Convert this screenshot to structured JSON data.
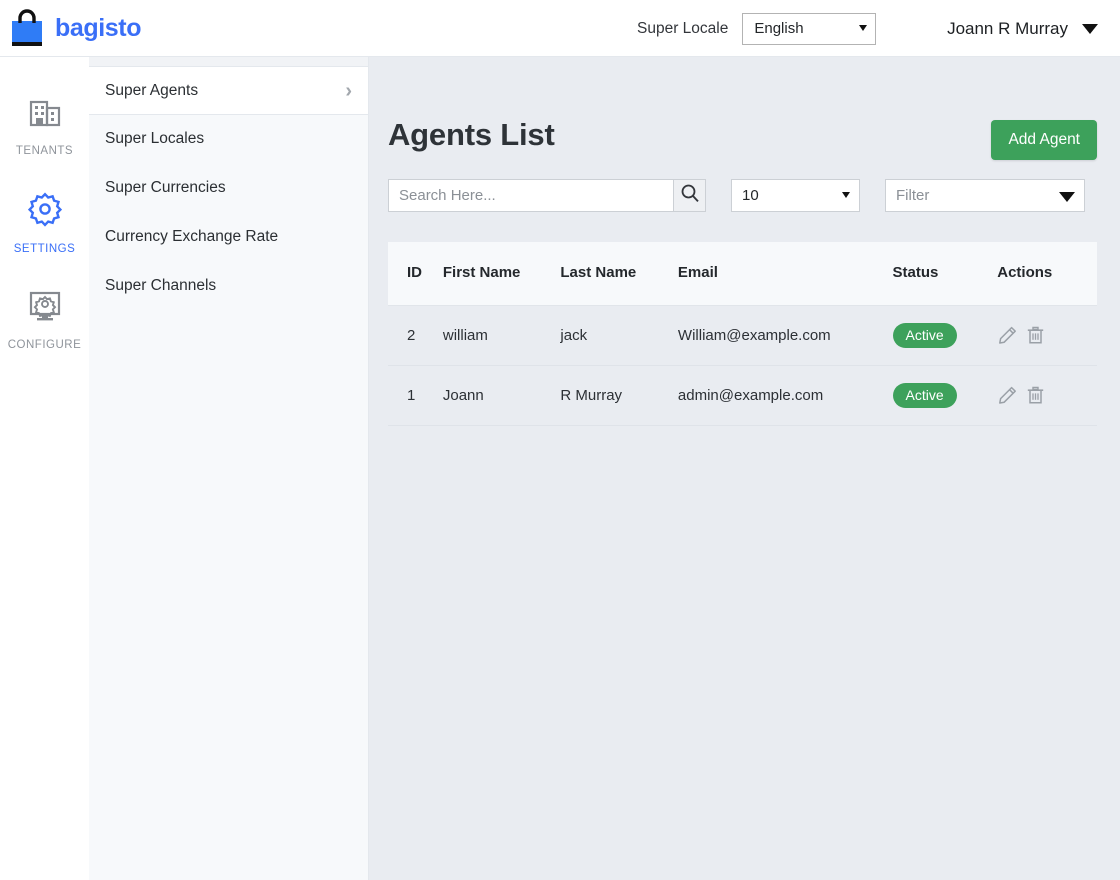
{
  "brand": {
    "name": "bagisto",
    "logo_icon": "shopping-bag-icon",
    "color": "#3a6ff7"
  },
  "header": {
    "super_locale_label": "Super Locale",
    "locale_value": "English",
    "locale_options": [
      "English"
    ],
    "user_name": "Joann R Murray",
    "user_caret_icon": "chevron-down-icon"
  },
  "rail": {
    "items": [
      {
        "label": "TENANTS",
        "icon": "building-icon",
        "active": false
      },
      {
        "label": "SETTINGS",
        "icon": "gear-icon",
        "active": true
      },
      {
        "label": "CONFIGURE",
        "icon": "monitor-gear-icon",
        "active": false
      }
    ]
  },
  "nav": {
    "items": [
      {
        "label": "Super Agents",
        "active": true,
        "chevron": "chevron-right-icon"
      },
      {
        "label": "Super Locales",
        "active": false
      },
      {
        "label": "Super Currencies",
        "active": false
      },
      {
        "label": "Currency Exchange Rate",
        "active": false
      },
      {
        "label": "Super Channels",
        "active": false
      }
    ]
  },
  "page": {
    "title": "Agents List",
    "add_button": "Add Agent",
    "add_button_color": "#3da15b"
  },
  "toolbar": {
    "search_placeholder": "Search Here...",
    "search_value": "",
    "search_icon": "search-icon",
    "per_page_value": "10",
    "per_page_options": [
      "10"
    ],
    "filter_placeholder": "Filter",
    "filter_value": ""
  },
  "table": {
    "columns": [
      "ID",
      "First Name",
      "Last Name",
      "Email",
      "Status",
      "Actions"
    ],
    "rows": [
      {
        "id": "2",
        "first_name": "william",
        "last_name": "jack",
        "email": "William@example.com",
        "status": "Active",
        "status_color": "#3da15b",
        "actions": [
          "edit-icon",
          "delete-icon"
        ]
      },
      {
        "id": "1",
        "first_name": "Joann",
        "last_name": "R Murray",
        "email": "admin@example.com",
        "status": "Active",
        "status_color": "#3da15b",
        "actions": [
          "edit-icon",
          "delete-icon"
        ]
      }
    ]
  }
}
